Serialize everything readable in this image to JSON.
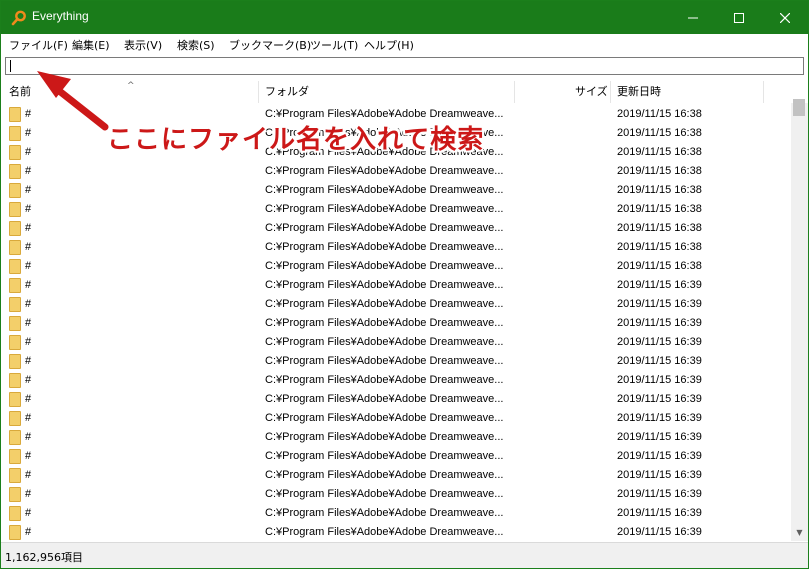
{
  "window": {
    "title": "Everything",
    "accent_color": "#1a7c1a",
    "icon": "magnifier-icon"
  },
  "menu": [
    {
      "label": "ファイル(F)"
    },
    {
      "label": "編集(E)"
    },
    {
      "label": "表示(V)"
    },
    {
      "label": "検索(S)"
    },
    {
      "label": "ブックマーク(B)"
    },
    {
      "label": "ツール(T)"
    },
    {
      "label": "ヘルプ(H)"
    }
  ],
  "search": {
    "value": ""
  },
  "columns": {
    "name": "名前",
    "path": "フォルダ",
    "size": "サイズ",
    "date": "更新日時"
  },
  "rows": [
    {
      "name": "#",
      "path": "C:¥Program Files¥Adobe¥Adobe Dreamweave...",
      "date": "2019/11/15 16:38"
    },
    {
      "name": "#",
      "path": "C:¥Program Files¥Adobe¥Adobe Dreamweave...",
      "date": "2019/11/15 16:38"
    },
    {
      "name": "#",
      "path": "C:¥Program Files¥Adobe¥Adobe Dreamweave...",
      "date": "2019/11/15 16:38"
    },
    {
      "name": "#",
      "path": "C:¥Program Files¥Adobe¥Adobe Dreamweave...",
      "date": "2019/11/15 16:38"
    },
    {
      "name": "#",
      "path": "C:¥Program Files¥Adobe¥Adobe Dreamweave...",
      "date": "2019/11/15 16:38"
    },
    {
      "name": "#",
      "path": "C:¥Program Files¥Adobe¥Adobe Dreamweave...",
      "date": "2019/11/15 16:38"
    },
    {
      "name": "#",
      "path": "C:¥Program Files¥Adobe¥Adobe Dreamweave...",
      "date": "2019/11/15 16:38"
    },
    {
      "name": "#",
      "path": "C:¥Program Files¥Adobe¥Adobe Dreamweave...",
      "date": "2019/11/15 16:38"
    },
    {
      "name": "#",
      "path": "C:¥Program Files¥Adobe¥Adobe Dreamweave...",
      "date": "2019/11/15 16:38"
    },
    {
      "name": "#",
      "path": "C:¥Program Files¥Adobe¥Adobe Dreamweave...",
      "date": "2019/11/15 16:39"
    },
    {
      "name": "#",
      "path": "C:¥Program Files¥Adobe¥Adobe Dreamweave...",
      "date": "2019/11/15 16:39"
    },
    {
      "name": "#",
      "path": "C:¥Program Files¥Adobe¥Adobe Dreamweave...",
      "date": "2019/11/15 16:39"
    },
    {
      "name": "#",
      "path": "C:¥Program Files¥Adobe¥Adobe Dreamweave...",
      "date": "2019/11/15 16:39"
    },
    {
      "name": "#",
      "path": "C:¥Program Files¥Adobe¥Adobe Dreamweave...",
      "date": "2019/11/15 16:39"
    },
    {
      "name": "#",
      "path": "C:¥Program Files¥Adobe¥Adobe Dreamweave...",
      "date": "2019/11/15 16:39"
    },
    {
      "name": "#",
      "path": "C:¥Program Files¥Adobe¥Adobe Dreamweave...",
      "date": "2019/11/15 16:39"
    },
    {
      "name": "#",
      "path": "C:¥Program Files¥Adobe¥Adobe Dreamweave...",
      "date": "2019/11/15 16:39"
    },
    {
      "name": "#",
      "path": "C:¥Program Files¥Adobe¥Adobe Dreamweave...",
      "date": "2019/11/15 16:39"
    },
    {
      "name": "#",
      "path": "C:¥Program Files¥Adobe¥Adobe Dreamweave...",
      "date": "2019/11/15 16:39"
    },
    {
      "name": "#",
      "path": "C:¥Program Files¥Adobe¥Adobe Dreamweave...",
      "date": "2019/11/15 16:39"
    },
    {
      "name": "#",
      "path": "C:¥Program Files¥Adobe¥Adobe Dreamweave...",
      "date": "2019/11/15 16:39"
    },
    {
      "name": "#",
      "path": "C:¥Program Files¥Adobe¥Adobe Dreamweave...",
      "date": "2019/11/15 16:39"
    },
    {
      "name": "#",
      "path": "C:¥Program Files¥Adobe¥Adobe Dreamweave...",
      "date": "2019/11/15 16:39"
    }
  ],
  "status": {
    "count": "1,162,956項目"
  },
  "annotation": {
    "text": "ここにファイル名を入れて検索",
    "color": "#cc1818"
  }
}
